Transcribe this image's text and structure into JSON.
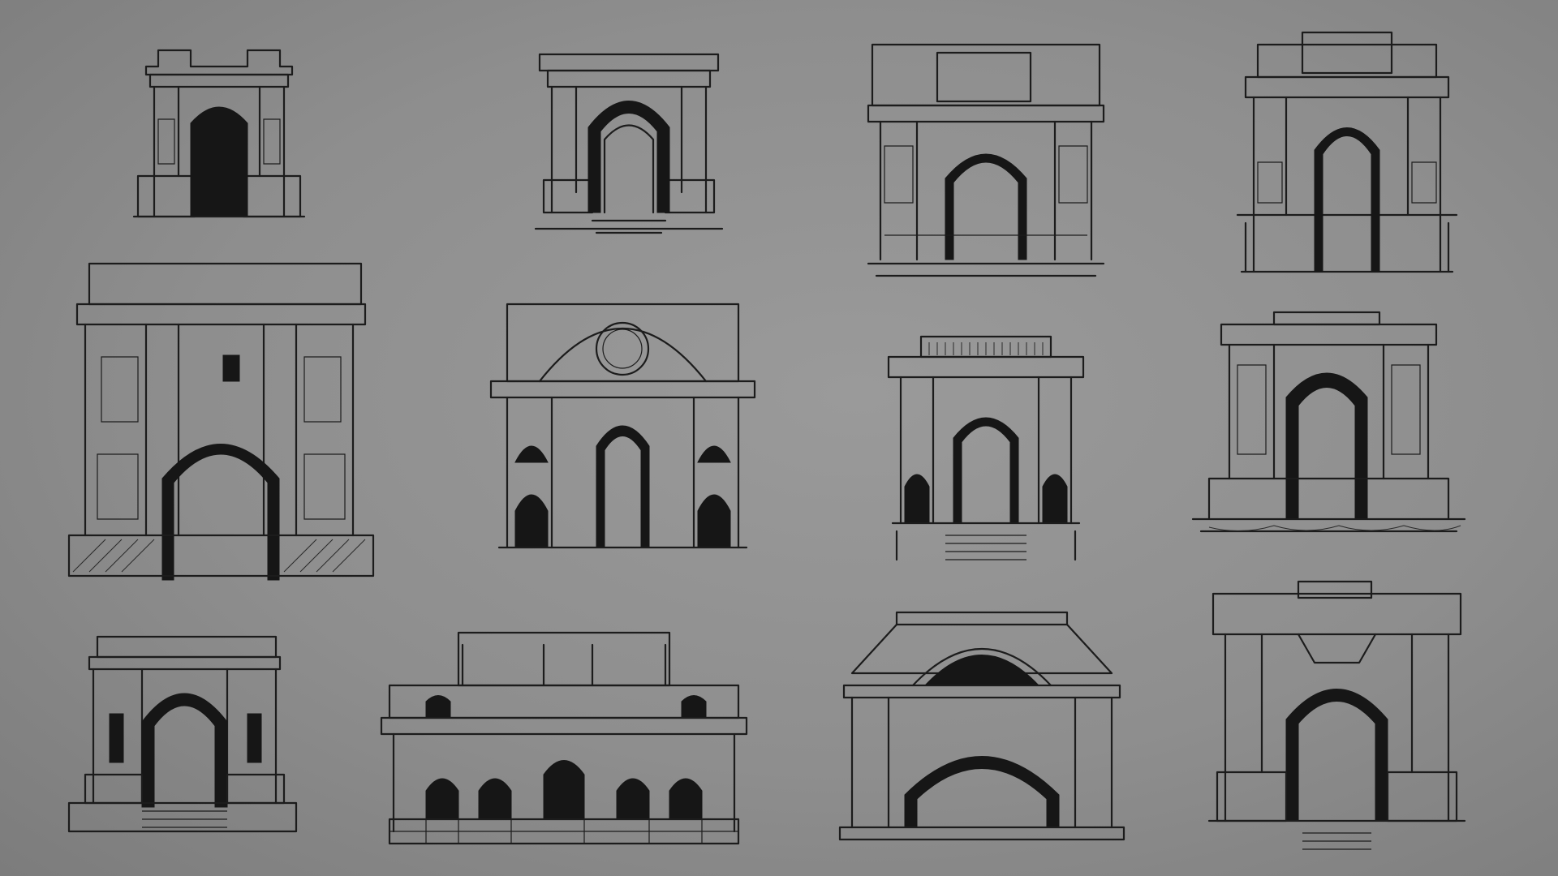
{
  "palette": {
    "paper": "#8e8e8e",
    "ink": "#1c1c1c",
    "shadow": "#161616"
  },
  "sketch_sheet": {
    "subject": "triumphal-arch-sketches",
    "count": 12
  }
}
